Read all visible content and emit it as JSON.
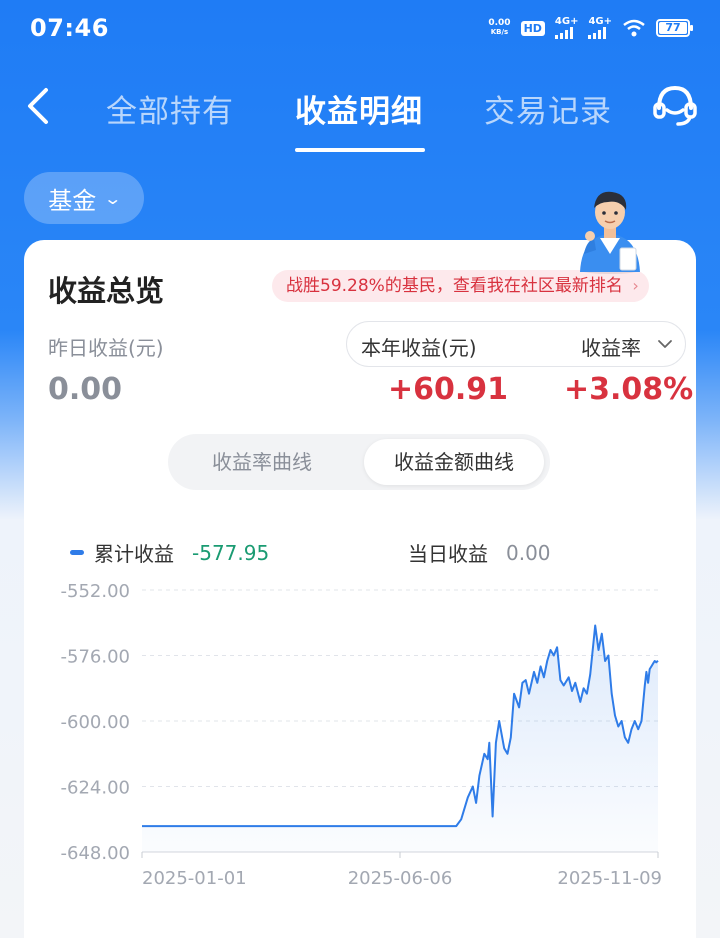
{
  "status_bar": {
    "time": "07:46",
    "net_speed_value": "0.00",
    "net_speed_unit": "KB/s",
    "hd_label": "HD",
    "signal1": "4G+",
    "signal2": "4G+",
    "battery": "77"
  },
  "nav": {
    "tabs": [
      {
        "label": "全部持有",
        "active": false
      },
      {
        "label": "收益明细",
        "active": true
      },
      {
        "label": "交易记录",
        "active": false
      }
    ]
  },
  "filter": {
    "selected": "基金"
  },
  "overview": {
    "title": "收益总览",
    "rank_text": "战胜59.28%的基民，查看我在社区最新排名",
    "yesterday_label": "昨日收益(元)",
    "yesterday_value": "0.00",
    "year_label": "本年收益(元)",
    "year_value": "+60.91",
    "rate_label": "收益率",
    "rate_value": "+3.08%"
  },
  "segment": {
    "options": [
      "收益率曲线",
      "收益金额曲线"
    ],
    "selected": "收益金额曲线"
  },
  "legend": {
    "cumulative_label": "累计收益",
    "cumulative_value": "-577.95",
    "daily_label": "当日收益",
    "daily_value": "0.00"
  },
  "colors": {
    "brand": "#1f7cf5",
    "positive": "#d8323f",
    "negative": "#1a9b72",
    "line": "#2f7ce8"
  },
  "chart_data": {
    "type": "area",
    "title": "",
    "xlabel": "",
    "ylabel": "",
    "ylim": [
      -648,
      -552
    ],
    "y_ticks": [
      "-552.00",
      "-576.00",
      "-600.00",
      "-624.00",
      "-648.00"
    ],
    "x_ticks": [
      "2025-01-01",
      "2025-06-06",
      "2025-11-09"
    ],
    "grid": true,
    "series": [
      {
        "name": "累计收益",
        "points": [
          [
            "2025-01-01",
            -638.5
          ],
          [
            "2025-02-15",
            -638.5
          ],
          [
            "2025-04-01",
            -638.5
          ],
          [
            "2025-05-15",
            -638.5
          ],
          [
            "2025-06-06",
            -638.5
          ],
          [
            "2025-07-10",
            -638.5
          ],
          [
            "2025-07-13",
            -636
          ],
          [
            "2025-07-17",
            -628
          ],
          [
            "2025-07-20",
            -624
          ],
          [
            "2025-07-22",
            -630
          ],
          [
            "2025-07-24",
            -620
          ],
          [
            "2025-07-27",
            -612
          ],
          [
            "2025-07-29",
            -614
          ],
          [
            "2025-07-30",
            -608
          ],
          [
            "2025-08-01",
            -635
          ],
          [
            "2025-08-03",
            -608
          ],
          [
            "2025-08-05",
            -600
          ],
          [
            "2025-08-08",
            -610
          ],
          [
            "2025-08-10",
            -612
          ],
          [
            "2025-08-12",
            -606
          ],
          [
            "2025-08-14",
            -590
          ],
          [
            "2025-08-17",
            -595
          ],
          [
            "2025-08-19",
            -586
          ],
          [
            "2025-08-21",
            -585
          ],
          [
            "2025-08-23",
            -590
          ],
          [
            "2025-08-26",
            -582
          ],
          [
            "2025-08-28",
            -586
          ],
          [
            "2025-08-30",
            -580
          ],
          [
            "2025-09-01",
            -584
          ],
          [
            "2025-09-03",
            -578
          ],
          [
            "2025-09-05",
            -574
          ],
          [
            "2025-09-07",
            -576
          ],
          [
            "2025-09-09",
            -573
          ],
          [
            "2025-09-11",
            -585
          ],
          [
            "2025-09-13",
            -587
          ],
          [
            "2025-09-16",
            -584
          ],
          [
            "2025-09-18",
            -589
          ],
          [
            "2025-09-20",
            -586
          ],
          [
            "2025-09-23",
            -593
          ],
          [
            "2025-09-25",
            -588
          ],
          [
            "2025-09-27",
            -590
          ],
          [
            "2025-09-29",
            -583
          ],
          [
            "2025-10-02",
            -565
          ],
          [
            "2025-10-04",
            -574
          ],
          [
            "2025-10-06",
            -568
          ],
          [
            "2025-10-08",
            -578
          ],
          [
            "2025-10-10",
            -576
          ],
          [
            "2025-10-12",
            -590
          ],
          [
            "2025-10-14",
            -598
          ],
          [
            "2025-10-16",
            -602
          ],
          [
            "2025-10-18",
            -600
          ],
          [
            "2025-10-20",
            -606
          ],
          [
            "2025-10-22",
            -608
          ],
          [
            "2025-10-24",
            -603
          ],
          [
            "2025-10-26",
            -600
          ],
          [
            "2025-10-28",
            -603
          ],
          [
            "2025-10-30",
            -600
          ],
          [
            "2025-11-01",
            -587
          ],
          [
            "2025-11-02",
            -582
          ],
          [
            "2025-11-03",
            -586
          ],
          [
            "2025-11-04",
            -581
          ],
          [
            "2025-11-05",
            -580
          ],
          [
            "2025-11-06",
            -579
          ],
          [
            "2025-11-07",
            -578
          ],
          [
            "2025-11-08",
            -578.5
          ],
          [
            "2025-11-09",
            -577.95
          ]
        ]
      }
    ]
  }
}
